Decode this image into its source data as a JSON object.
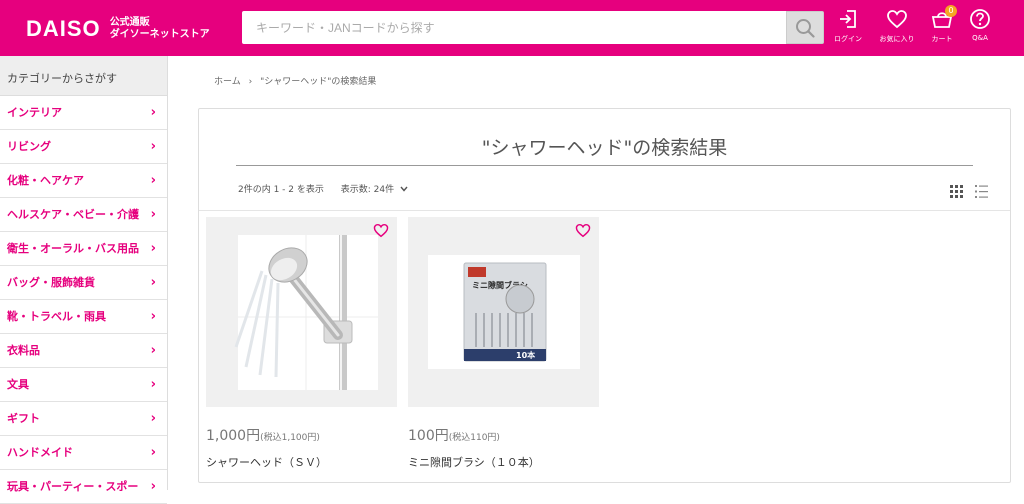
{
  "header": {
    "brand": "DAISO",
    "sub_line1": "公式通販",
    "sub_line2": "ダイソーネットストア",
    "search_placeholder": "キーワード・JANコードから探す",
    "login_label": "ログイン",
    "favorites_label": "お気に入り",
    "cart_label": "カート",
    "cart_count": "0",
    "qa_label": "Q&A"
  },
  "sidebar": {
    "title": "カテゴリーからさがす",
    "items": [
      {
        "label": "インテリア"
      },
      {
        "label": "リビング"
      },
      {
        "label": "化粧・ヘアケア"
      },
      {
        "label": "ヘルスケア・ベビー・介護"
      },
      {
        "label": "衛生・オーラル・バス用品"
      },
      {
        "label": "バッグ・服飾雑貨"
      },
      {
        "label": "靴・トラベル・雨具"
      },
      {
        "label": "衣料品"
      },
      {
        "label": "文具"
      },
      {
        "label": "ギフト"
      },
      {
        "label": "ハンドメイド"
      },
      {
        "label": "玩具・パーティー・スポー"
      }
    ]
  },
  "breadcrumb": {
    "home": "ホーム",
    "separator": "›",
    "current": "\"シャワーヘッド\"の検索結果"
  },
  "results": {
    "title": "\"シャワーヘッド\"の検索結果",
    "count_text": "2件の内 1 - 2 を表示",
    "per_page_text": "表示数: 24件"
  },
  "products": [
    {
      "price": "1,000円",
      "tax": "(税込1,100円)",
      "name": "シャワーヘッド（ＳＶ）"
    },
    {
      "price": "100円",
      "tax": "(税込110円)",
      "name": "ミニ隙間ブラシ（１０本）",
      "package_label": "ミニ隙間ブラシ",
      "package_count": "10本"
    }
  ],
  "colors": {
    "brand_pink": "#e6007e",
    "badge_orange": "#f5a623"
  },
  "icons": {
    "search": "search-icon",
    "login": "login-icon",
    "favorites": "heart-icon",
    "cart": "cart-icon",
    "qa": "help-icon",
    "grid_view": "grid-view-icon",
    "list_view": "list-view-icon",
    "chevron": "chevron-right-icon"
  }
}
